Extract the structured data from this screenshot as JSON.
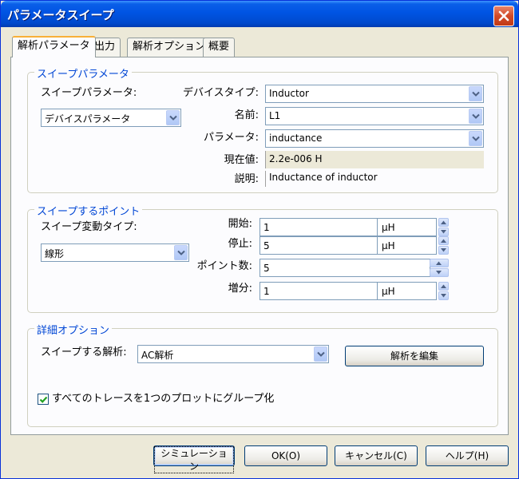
{
  "window": {
    "title": "パラメータスイープ"
  },
  "tabs": [
    {
      "label": "解析パラメータ"
    },
    {
      "label": "出力"
    },
    {
      "label": "解析オプション"
    },
    {
      "label": "概要"
    }
  ],
  "sweep_params": {
    "group_title": "スイープパラメータ",
    "param_label": "スイープパラメータ:",
    "param_value": "デバイスパラメータ",
    "device_type_label": "デバイスタイプ:",
    "device_type_value": "Inductor",
    "name_label": "名前:",
    "name_value": "L1",
    "parameter_label": "パラメータ:",
    "parameter_value": "inductance",
    "current_label": "現在値:",
    "current_value": "2.2e-006 H",
    "desc_label": "説明:",
    "desc_value": "Inductance of inductor"
  },
  "sweep_points": {
    "group_title": "スイープするポイント",
    "vartype_label": "スイープ変動タイプ:",
    "vartype_value": "線形",
    "start_label": "開始:",
    "start_value": "1",
    "start_unit": "μH",
    "stop_label": "停止:",
    "stop_value": "5",
    "stop_unit": "μH",
    "points_label": "ポイント数:",
    "points_value": "5",
    "incr_label": "増分:",
    "incr_value": "1",
    "incr_unit": "μH"
  },
  "detail": {
    "group_title": "詳細オプション",
    "analysis_label": "スイープする解析:",
    "analysis_value": "AC解析",
    "edit_button": "解析を編集",
    "group_checkbox_label": "すべてのトレースを1つのプロットにグループ化",
    "group_checked": true
  },
  "buttons": {
    "simulate": "シミュレーション",
    "ok": "OK(O)",
    "cancel": "キャンセル(C)",
    "help": "ヘルプ(H)"
  }
}
